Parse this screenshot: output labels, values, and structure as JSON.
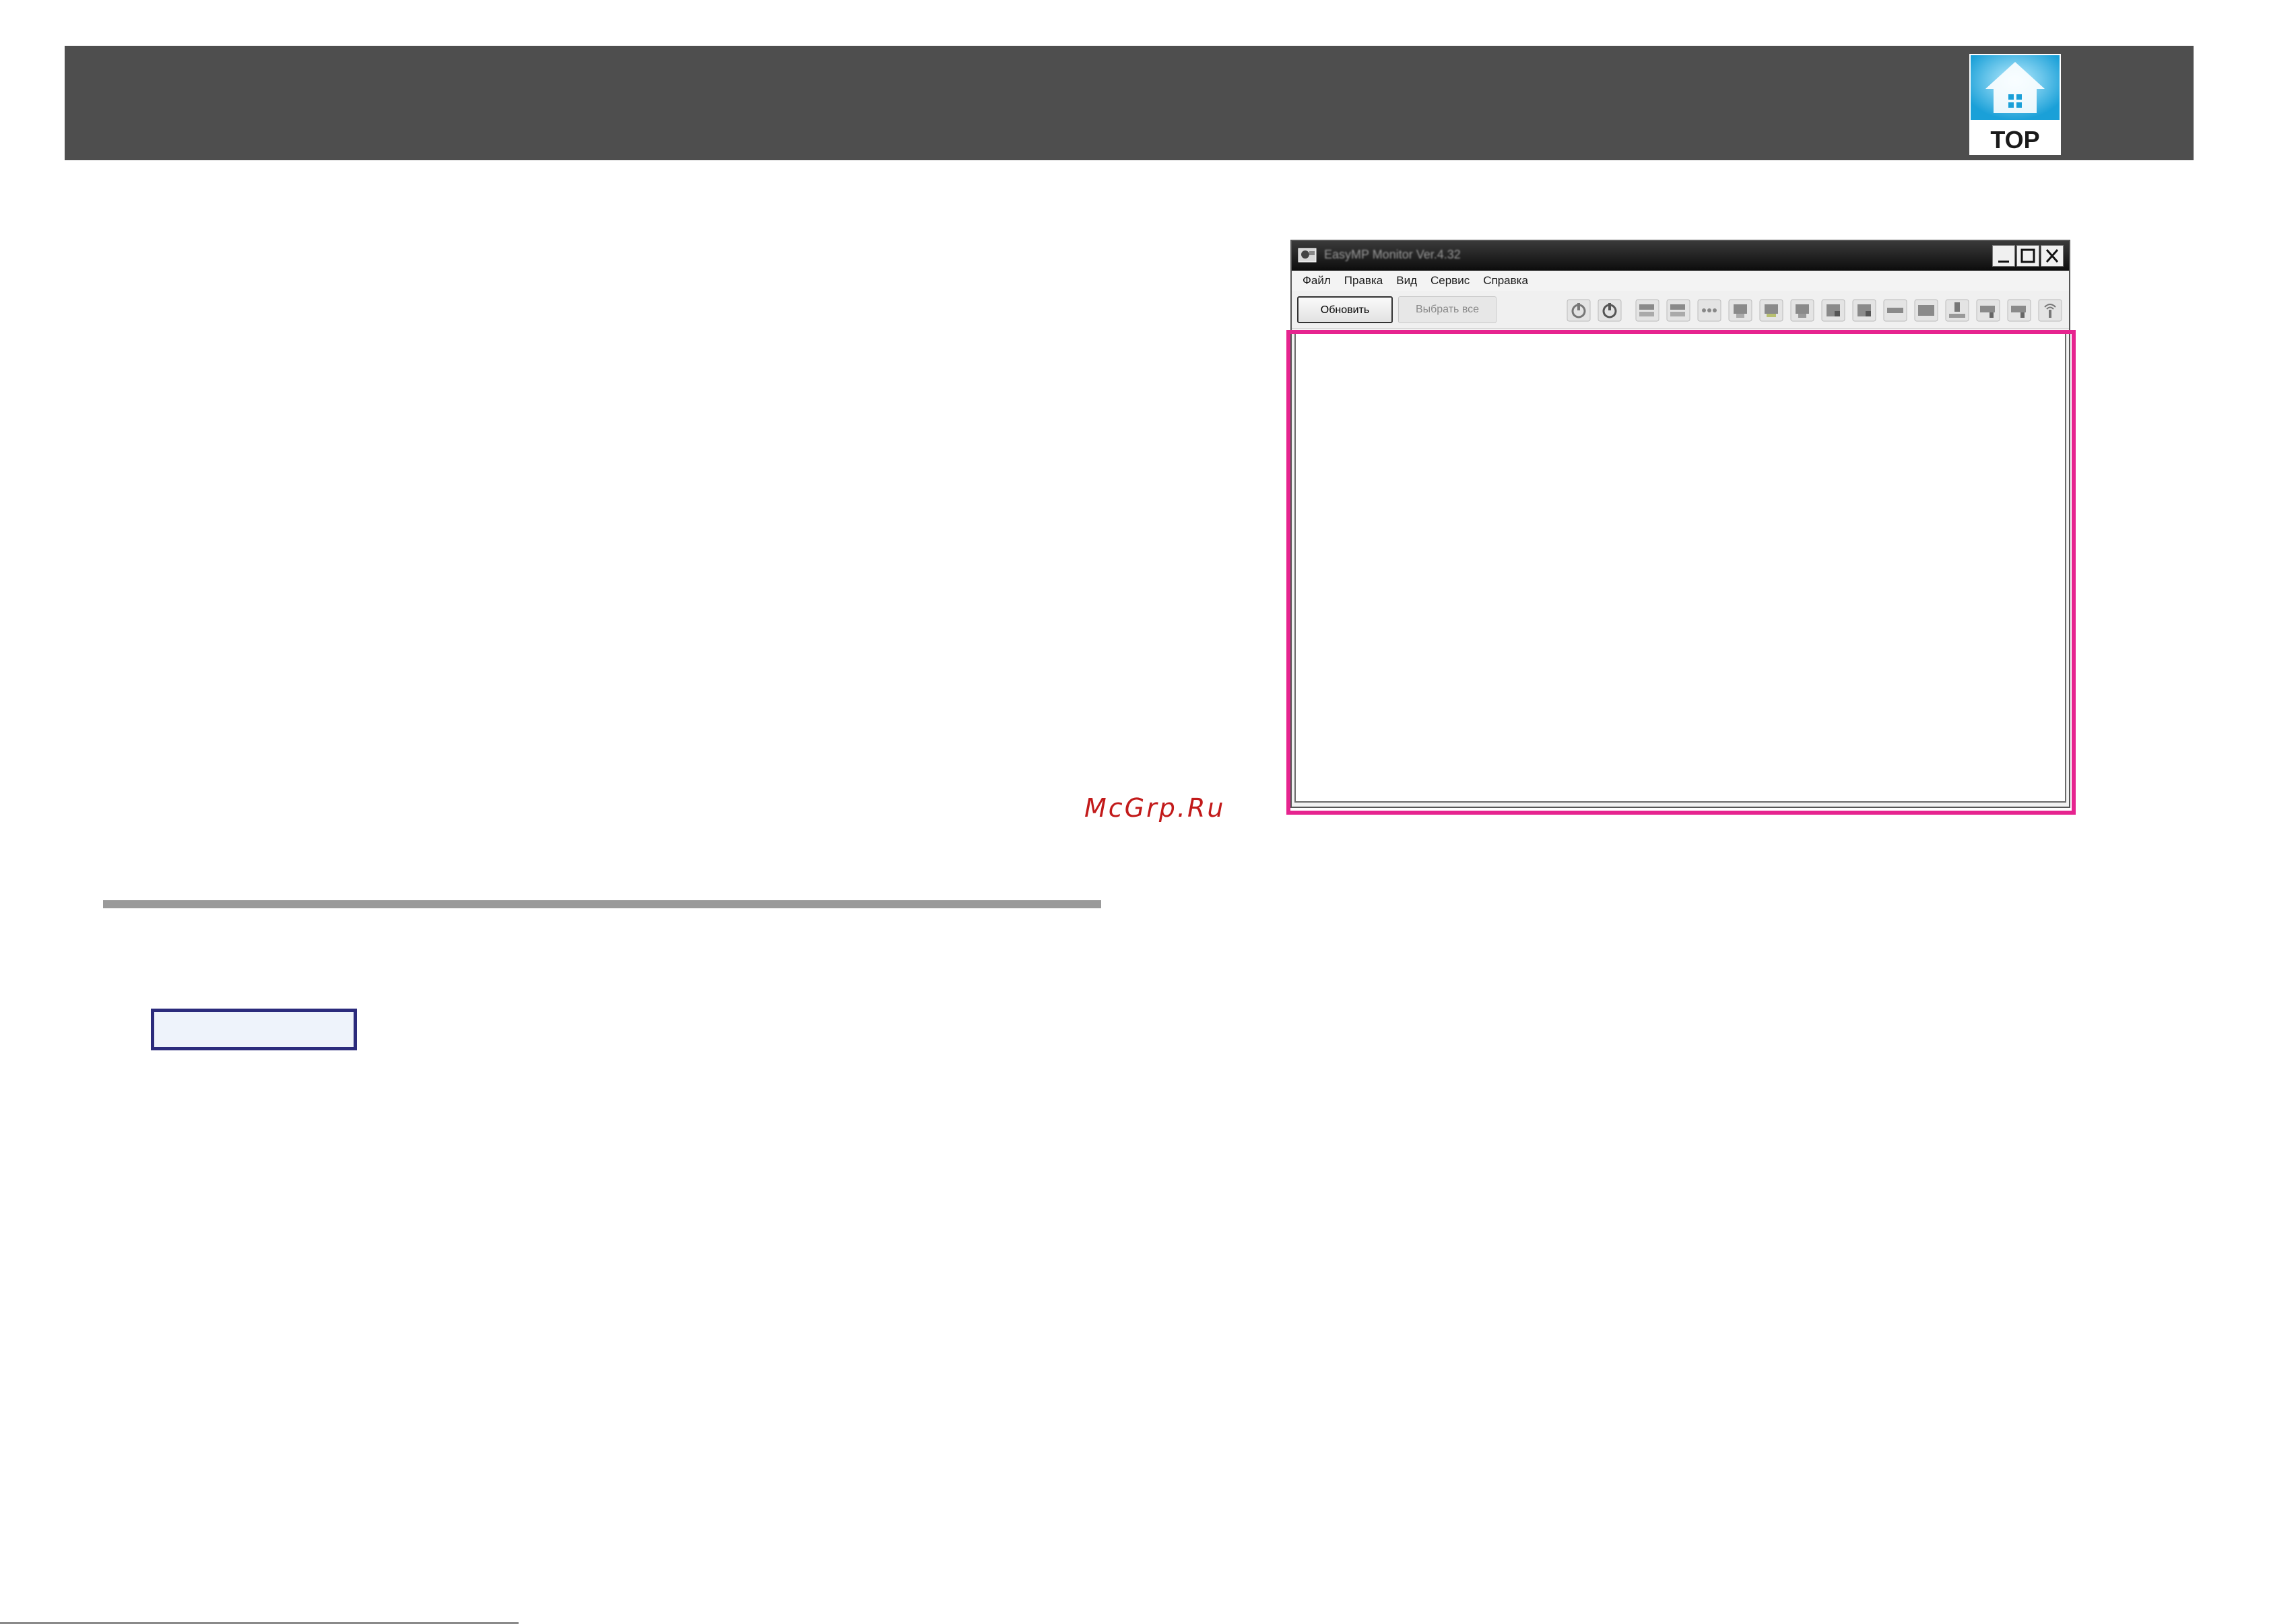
{
  "header": {
    "logo_text": "TOP",
    "logo_icon": "house-top-icon",
    "accent_color": "#4e4e4e"
  },
  "watermark": "McGrp.Ru",
  "app_window": {
    "title": "EasyMP Monitor Ver.4.32",
    "window_controls": [
      "minimize-icon",
      "maximize-icon",
      "close-icon"
    ],
    "menu": [
      "Файл",
      "Правка",
      "Вид",
      "Сервис",
      "Справка"
    ],
    "buttons": {
      "refresh": "Обновить",
      "select_all": "Выбрать все"
    },
    "toolbar_icons": [
      "power-on-icon",
      "power-off-icon",
      "source-computer-icon",
      "source-video-icon",
      "source-network-icon",
      "source-usb-icon",
      "source-hdmi-icon",
      "source-s-video-icon",
      "source-input-a-icon",
      "source-input-b-icon",
      "av-mute-icon",
      "freeze-icon",
      "document-camera-icon",
      "projector-icon",
      "projector-settings-icon",
      "wireless-icon"
    ]
  },
  "highlight_color": "#e6248f"
}
